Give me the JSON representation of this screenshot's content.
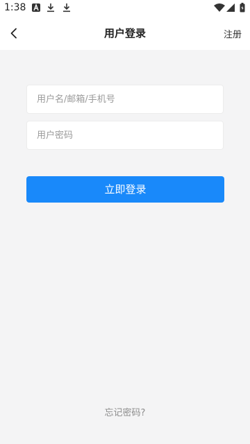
{
  "status_bar": {
    "time": "1:38",
    "icons": [
      "a-notification-icon",
      "download-icon",
      "download-icon",
      "wifi-icon",
      "signal-icon",
      "battery-icon"
    ]
  },
  "header": {
    "title": "用户登录",
    "register_label": "注册",
    "back_icon": "chevron-left-icon"
  },
  "form": {
    "username_placeholder": "用户名/邮箱/手机号",
    "username_value": "",
    "password_placeholder": "用户密码",
    "password_value": "",
    "login_label": "立即登录"
  },
  "footer": {
    "forgot_label": "忘记密码?"
  },
  "colors": {
    "accent": "#1989fa",
    "background": "#f4f4f5"
  }
}
